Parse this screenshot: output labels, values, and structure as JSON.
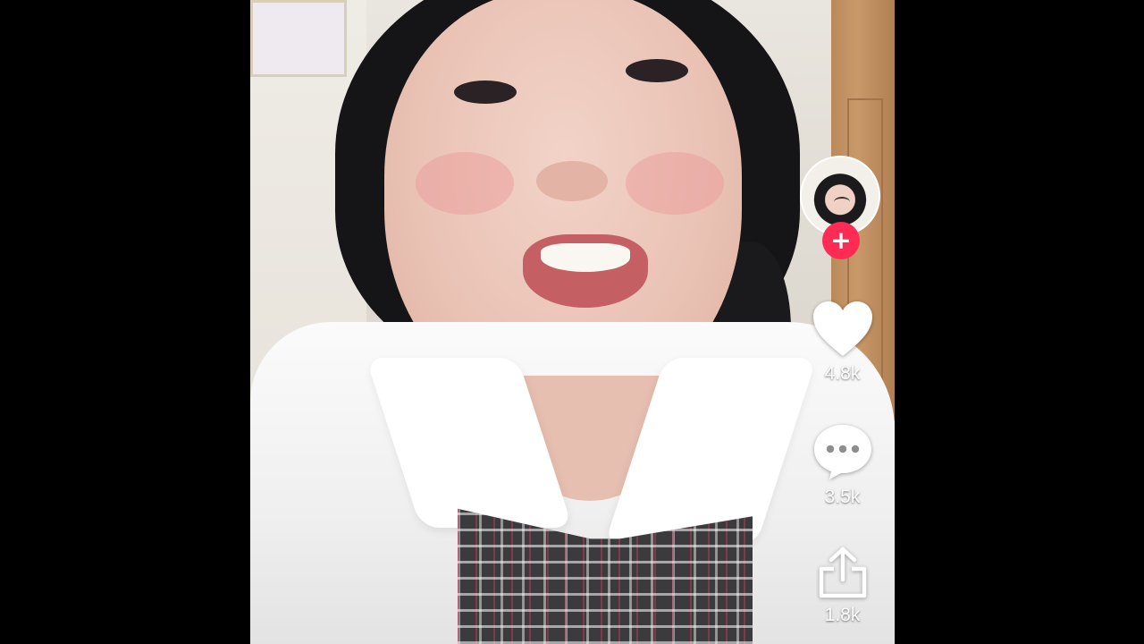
{
  "video": {
    "description": ""
  },
  "rail": {
    "avatar_icon": "creator-avatar",
    "follow_icon": "plus-icon",
    "follow_glyph": "+",
    "like": {
      "icon": "heart-icon",
      "count": "4.8k"
    },
    "comment": {
      "icon": "speech-bubble-icon",
      "count": "3.5k"
    },
    "share": {
      "icon": "share-arrow-icon",
      "count": "1.8k"
    }
  },
  "colors": {
    "background": "#000000",
    "follow_accent": "#fe2c55",
    "icon_fill": "#ffffff"
  }
}
